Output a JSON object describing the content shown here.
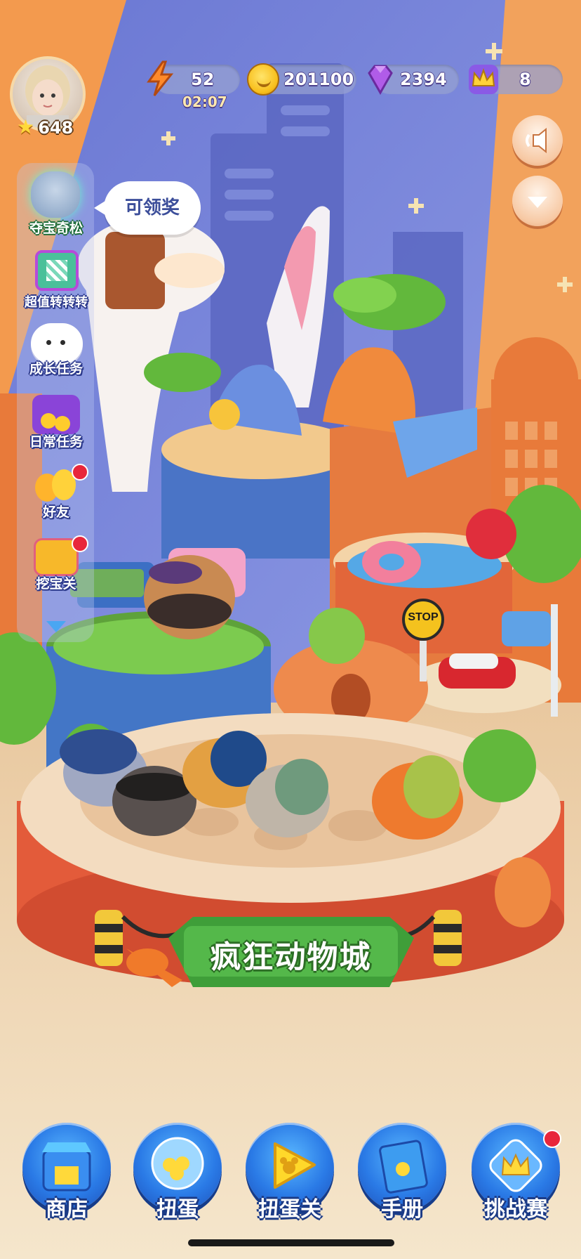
{
  "colors": {
    "sky_orange": "#f39a4e",
    "sky_blue": "#6f7ed6",
    "ground": "#f1d6b3",
    "accent_blue": "#2a7ae6",
    "badge_red": "#e8263b"
  },
  "player": {
    "level": "648"
  },
  "resources": {
    "energy": {
      "value": "52",
      "timer": "02:07",
      "icon": "lightning-icon"
    },
    "coins": {
      "value": "201100",
      "icon": "coin-icon"
    },
    "gems": {
      "value": "2394",
      "icon": "gem-icon"
    },
    "crowns": {
      "value": "8",
      "icon": "crown-icon"
    }
  },
  "right_controls": {
    "sound": {
      "icon": "speaker-icon"
    },
    "expand": {
      "icon": "chevron-down-icon"
    }
  },
  "side_menu": {
    "tooltip": "可领奖",
    "items": [
      {
        "label": "夺宝奇松",
        "icon": "treasure-plush-icon",
        "badge": false
      },
      {
        "label": "超值转转转",
        "icon": "slot-machine-icon",
        "badge": false
      },
      {
        "label": "成长任务",
        "icon": "cloud-ghost-icon",
        "badge": false
      },
      {
        "label": "日常任务",
        "icon": "coin-chest-icon",
        "badge": false
      },
      {
        "label": "好友",
        "icon": "chick-friends-icon",
        "badge": true
      },
      {
        "label": "挖宝关",
        "icon": "gold-chest-icon",
        "badge": true
      }
    ]
  },
  "scene": {
    "banner": "疯狂动物城",
    "stop_sign": "STOP"
  },
  "bottom_nav": [
    {
      "label": "商店",
      "icon": "shop-icon",
      "badge": false
    },
    {
      "label": "扭蛋",
      "icon": "gacha-icon",
      "badge": false
    },
    {
      "label": "扭蛋关",
      "icon": "play-mickey-icon",
      "badge": false
    },
    {
      "label": "手册",
      "icon": "book-icon",
      "badge": false
    },
    {
      "label": "挑战赛",
      "icon": "challenge-crown-icon",
      "badge": true
    }
  ]
}
